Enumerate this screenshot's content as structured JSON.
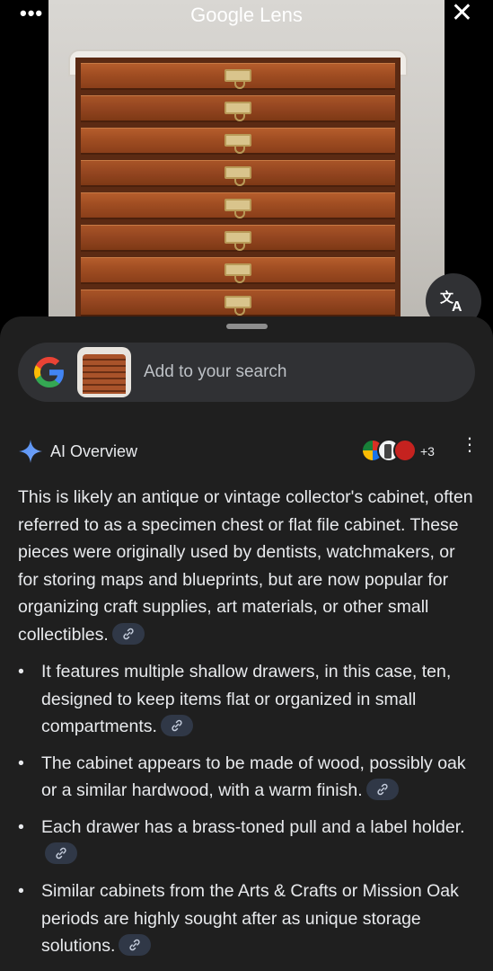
{
  "top_bar": {
    "menu_icon": "more-horizontal-icon",
    "title": "Google Lens",
    "close_icon": "close-icon"
  },
  "image": {
    "subject": "wooden-drawer-cabinet",
    "translate_icon": "translate-icon"
  },
  "search": {
    "placeholder": "Add to your search"
  },
  "overview": {
    "title": "AI Overview",
    "sources_more": "+3",
    "summary": "This is likely an antique or vintage collector's cabinet, often referred to as a specimen chest or flat file cabinet. These pieces were originally used by dentists, watchmakers, or for storing maps and blueprints, but are now popular for organizing craft supplies, art materials, or other small collectibles.",
    "bullets": [
      "It features multiple shallow drawers, in this case, ten, designed to keep items flat or organized in small compartments.",
      "The cabinet appears to be made of wood, possibly oak or a similar hardwood, with a warm finish.",
      "Each drawer has a brass-toned pull and a label holder.",
      "Similar cabinets from the Arts & Crafts or Mission Oak periods are highly sought after as unique storage solutions."
    ]
  },
  "colors": {
    "sheet_bg": "#1f1f1f",
    "pill_bg": "#303134",
    "text": "#e8eaed",
    "link_chip_bg": "#303847"
  }
}
